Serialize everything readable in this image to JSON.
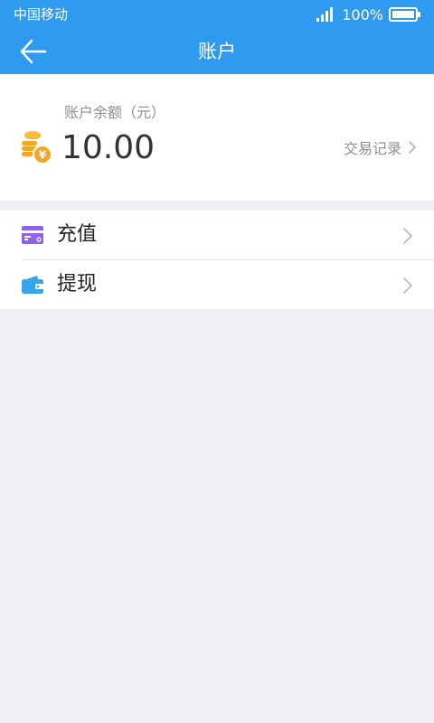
{
  "status_bar": {
    "carrier": "中国移动",
    "battery_percent": "100%",
    "signal_icon": "signal-bars-icon",
    "battery_icon": "battery-full-icon"
  },
  "header": {
    "title": "账户",
    "back_icon": "arrow-left-icon"
  },
  "balance": {
    "label": "账户余额（元）",
    "amount": "10.00",
    "icon": "coins-yuan-icon",
    "history_label": "交易记录"
  },
  "menu": {
    "items": [
      {
        "label": "充值",
        "icon": "credit-card-icon"
      },
      {
        "label": "提现",
        "icon": "wallet-icon"
      }
    ]
  },
  "colors": {
    "primary": "#2f9bf0",
    "background": "#efeff4",
    "coin": "#f5a623",
    "recharge_icon": "#8f63e8",
    "wallet_icon": "#36a6ec",
    "secondary_text": "#8e8e8e"
  }
}
